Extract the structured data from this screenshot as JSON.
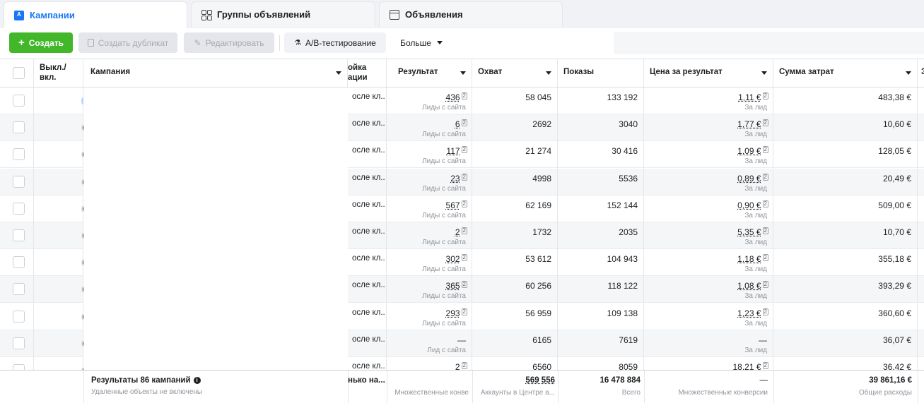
{
  "tabs": [
    {
      "label": "Кампании",
      "icon": "campaign-icon"
    },
    {
      "label": "Группы объявлений",
      "icon": "ad-sets-icon"
    },
    {
      "label": "Объявления",
      "icon": "ads-icon"
    }
  ],
  "toolbar": {
    "create_label": "Создать",
    "duplicate_label": "Создать дубликат",
    "edit_label": "Редактировать",
    "ab_label": "A/B-тестирование",
    "more_label": "Больше"
  },
  "columns": {
    "toggle": "Выкл./\nвкл.",
    "campaign": "Кампания",
    "attribution": "ойка\nации",
    "result": "Результат",
    "reach": "Охват",
    "impressions": "Показы",
    "cost_per_result": "Цена за результат",
    "amount_spent": "Сумма затрат",
    "next": "З"
  },
  "rows": [
    {
      "on": true,
      "attr": "осле кл...",
      "result": "436",
      "result_sub": "Лиды с сайта",
      "reach": "58 045",
      "impr": "133 192",
      "cpr": "1,11 €",
      "cpr_sub": "За лид",
      "spent": "483,38 €"
    },
    {
      "on": false,
      "attr": "осле кл...",
      "result": "6",
      "result_sub": "Лиды с сайта",
      "reach": "2692",
      "impr": "3040",
      "cpr": "1,77 €",
      "cpr_sub": "За лид",
      "spent": "10,60 €"
    },
    {
      "on": false,
      "attr": "осле кл...",
      "result": "117",
      "result_sub": "Лиды с сайта",
      "reach": "21 274",
      "impr": "30 416",
      "cpr": "1,09 €",
      "cpr_sub": "За лид",
      "spent": "128,05 €"
    },
    {
      "on": false,
      "attr": "осле кл...",
      "result": "23",
      "result_sub": "Лиды с сайта",
      "reach": "4998",
      "impr": "5536",
      "cpr": "0,89 €",
      "cpr_sub": "За лид",
      "spent": "20,49 €"
    },
    {
      "on": false,
      "attr": "осле кл...",
      "result": "567",
      "result_sub": "Лиды с сайта",
      "reach": "62 169",
      "impr": "152 144",
      "cpr": "0,90 €",
      "cpr_sub": "За лид",
      "spent": "509,00 €"
    },
    {
      "on": false,
      "attr": "осле кл...",
      "result": "2",
      "result_sub": "Лиды с сайта",
      "reach": "1732",
      "impr": "2035",
      "cpr": "5,35 €",
      "cpr_sub": "За лид",
      "spent": "10,70 €"
    },
    {
      "on": false,
      "attr": "осле кл...",
      "result": "302",
      "result_sub": "Лиды с сайта",
      "reach": "53 612",
      "impr": "104 943",
      "cpr": "1,18 €",
      "cpr_sub": "За лид",
      "spent": "355,18 €"
    },
    {
      "on": false,
      "attr": "осле кл...",
      "result": "365",
      "result_sub": "Лиды с сайта",
      "reach": "60 256",
      "impr": "118 122",
      "cpr": "1,08 €",
      "cpr_sub": "За лид",
      "spent": "393,29 €"
    },
    {
      "on": false,
      "attr": "осле кл...",
      "result": "293",
      "result_sub": "Лиды с сайта",
      "reach": "56 959",
      "impr": "109 138",
      "cpr": "1,23 €",
      "cpr_sub": "За лид",
      "spent": "360,60 €"
    },
    {
      "on": false,
      "attr": "осле кл...",
      "result": "—",
      "result_sub": "Лид с сайта",
      "reach": "6165",
      "impr": "7619",
      "cpr": "—",
      "cpr_sub": "За лид",
      "spent": "36,07 €"
    },
    {
      "on": false,
      "attr": "осле кл...",
      "result": "2",
      "result_sub": "",
      "reach": "6560",
      "impr": "8059",
      "cpr": "18,21 €",
      "cpr_sub": "",
      "spent": "36,42 €"
    }
  ],
  "footer": {
    "title": "Результаты 86 кампаний",
    "note": "Удаленные объекты не включены",
    "attr": "нько на...",
    "result_sub": "Множественные конве",
    "reach": "569 556",
    "reach_sub": "Аккаунты в Центре а...",
    "impr": "16 478 884",
    "impr_sub": "Всего",
    "cpr": "—",
    "cpr_sub": "Множественные конверсии",
    "spent": "39 861,16 €",
    "spent_sub": "Общие расходы"
  }
}
